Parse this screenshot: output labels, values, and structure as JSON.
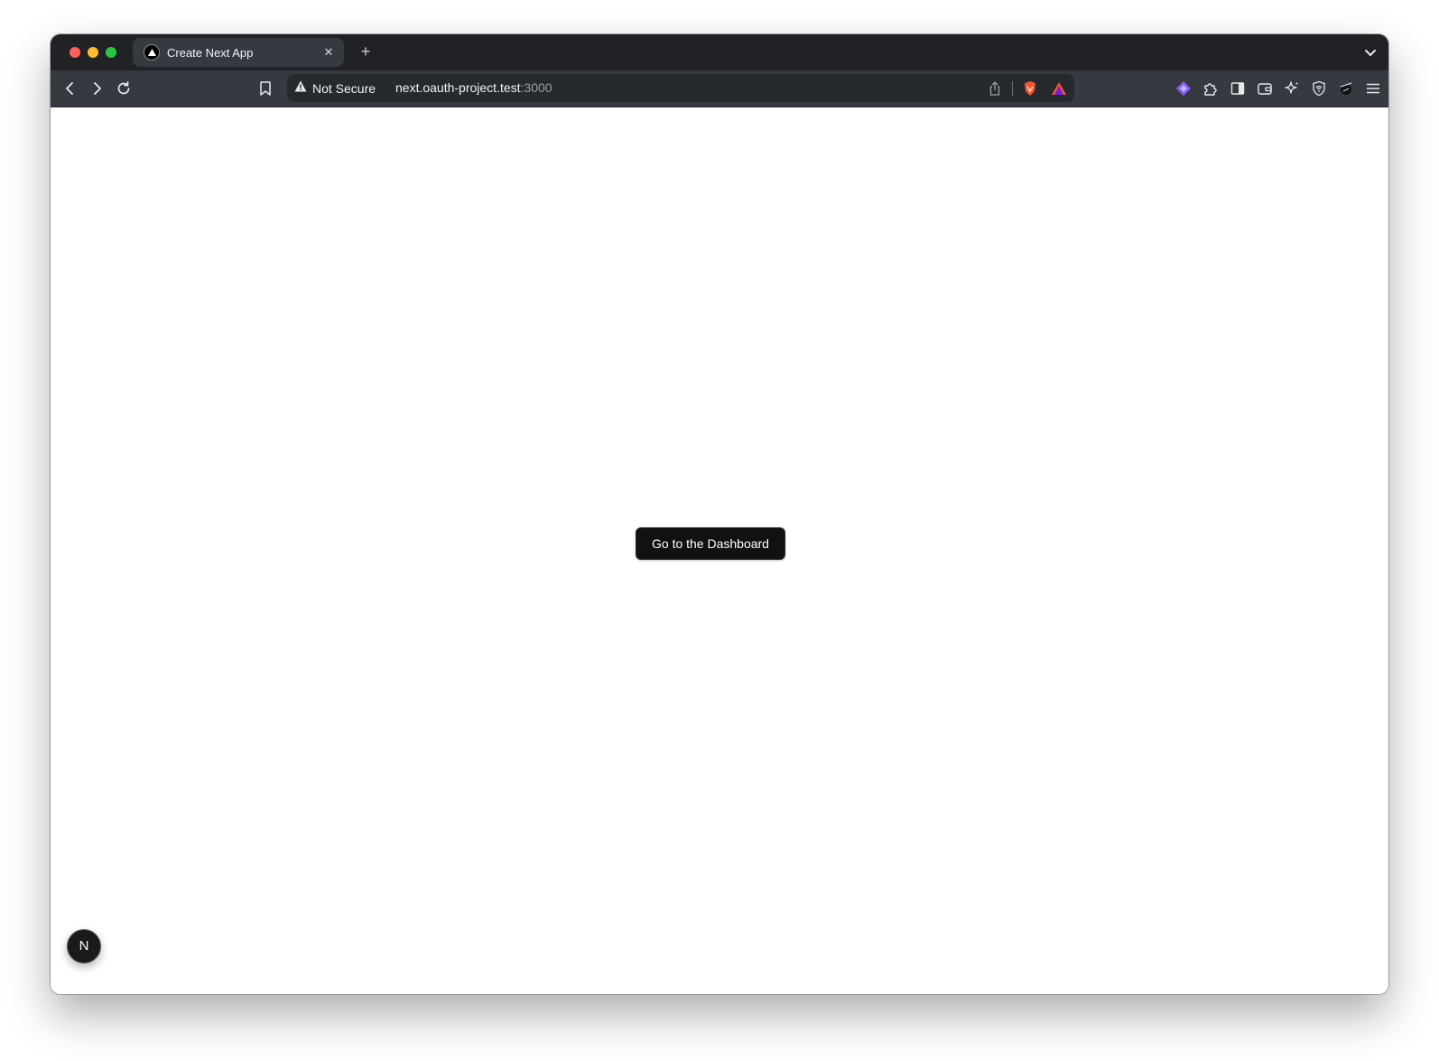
{
  "window": {
    "traffic_lights": [
      "close",
      "minimize",
      "zoom"
    ]
  },
  "tabs": [
    {
      "title": "Create Next App",
      "favicon": "next-triangle-icon",
      "close_glyph": "✕"
    }
  ],
  "new_tab_glyph": "+",
  "toolbar": {
    "security_label": "Not Secure",
    "url_host": "next.oauth-project.test",
    "url_port": ":3000"
  },
  "page": {
    "cta_label": "Go to the Dashboard",
    "dev_badge_label": "N"
  },
  "colors": {
    "tabstrip": "#202226",
    "toolbar": "#353a41",
    "urlbar": "#26292e",
    "cta_bg": "#111111",
    "brave_orange": "#fb542b"
  },
  "icons": [
    "back-icon",
    "forward-icon",
    "reload-icon",
    "bookmark-icon",
    "warning-icon",
    "share-icon",
    "brave-shields-icon",
    "brave-rewards-icon",
    "leo-ai-icon",
    "extensions-icon",
    "sidebar-icon",
    "wallet-icon",
    "ai-sparkle-icon",
    "vpn-shield-icon",
    "profile-extension-icon",
    "menu-icon",
    "tab-list-chevron-icon"
  ]
}
